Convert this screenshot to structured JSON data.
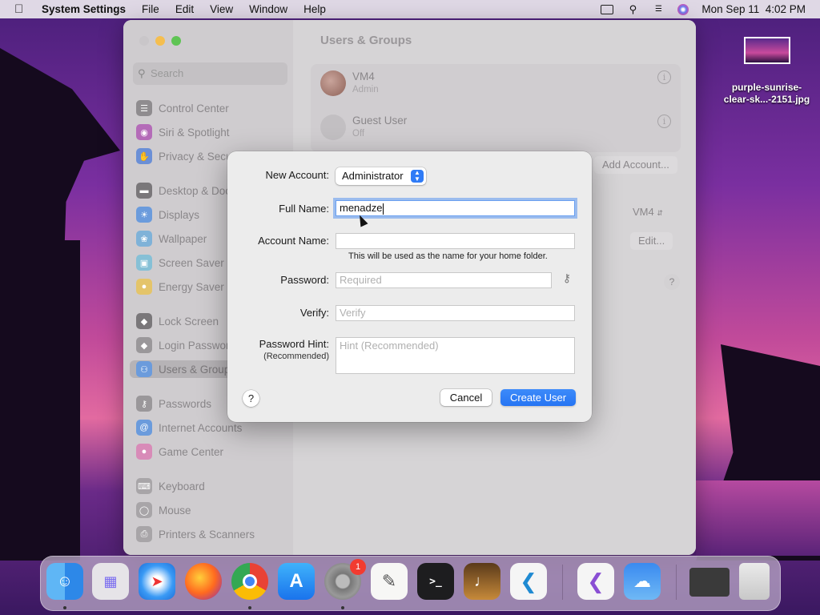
{
  "menubar": {
    "app_name": "System Settings",
    "menus": [
      "File",
      "Edit",
      "View",
      "Window",
      "Help"
    ],
    "clock": "Mon Sep 11  4:02 PM"
  },
  "desktop": {
    "file_name_line1": "purple-sunrise-",
    "file_name_line2": "clear-sk...-2151.jpg"
  },
  "window": {
    "title": "Users & Groups",
    "search_placeholder": "Search",
    "sidebar": [
      {
        "label": "Control Center",
        "icon": "control-center-icon",
        "color": "#8f8c8f"
      },
      {
        "label": "Siri & Spotlight",
        "icon": "siri-icon",
        "color": "#b46bb8"
      },
      {
        "label": "Privacy & Security",
        "icon": "hand-icon",
        "color": "#6b8fd6"
      },
      {
        "label": "Desktop & Dock",
        "icon": "dock-icon",
        "color": "#7a777a"
      },
      {
        "label": "Displays",
        "icon": "sun-icon",
        "color": "#6b9bdc"
      },
      {
        "label": "Wallpaper",
        "icon": "wallpaper-icon",
        "color": "#7fb2d8"
      },
      {
        "label": "Screen Saver",
        "icon": "screensaver-icon",
        "color": "#86c0d6"
      },
      {
        "label": "Energy Saver",
        "icon": "bulb-icon",
        "color": "#e4c46a"
      },
      {
        "label": "Lock Screen",
        "icon": "lock-icon",
        "color": "#7a777a"
      },
      {
        "label": "Login Password",
        "icon": "lock-icon",
        "color": "#9a979a"
      },
      {
        "label": "Users & Groups",
        "icon": "users-icon",
        "color": "#6b9bdc"
      },
      {
        "label": "Passwords",
        "icon": "key-icon",
        "color": "#9a979a"
      },
      {
        "label": "Internet Accounts",
        "icon": "at-icon",
        "color": "#6b9bdc"
      },
      {
        "label": "Game Center",
        "icon": "game-center-icon",
        "color": "#d88bb8"
      },
      {
        "label": "Keyboard",
        "icon": "keyboard-icon",
        "color": "#a8a5a8"
      },
      {
        "label": "Mouse",
        "icon": "mouse-icon",
        "color": "#a8a5a8"
      },
      {
        "label": "Printers & Scanners",
        "icon": "printer-icon",
        "color": "#a8a5a8"
      }
    ],
    "users": [
      {
        "name": "VM4",
        "role": "Admin"
      },
      {
        "name": "Guest User",
        "role": "Off"
      }
    ],
    "add_account_label": "Add Account...",
    "auto_login_value": "VM4",
    "edit_label": "Edit...",
    "help_label": "?"
  },
  "sheet": {
    "new_account_label": "New Account:",
    "new_account_value": "Administrator",
    "full_name_label": "Full Name:",
    "full_name_value": "menadze",
    "account_name_label": "Account Name:",
    "account_name_value": "",
    "account_name_help": "This will be used as the name for your home folder.",
    "password_label": "Password:",
    "password_placeholder": "Required",
    "verify_label": "Verify:",
    "verify_placeholder": "Verify",
    "hint_label": "Password Hint:",
    "hint_sublabel": "(Recommended)",
    "hint_placeholder": "Hint (Recommended)",
    "help_label": "?",
    "cancel_label": "Cancel",
    "create_label": "Create User"
  },
  "dock": {
    "apps": [
      "Finder",
      "Launchpad",
      "Safari",
      "Firefox",
      "Chrome",
      "App Store",
      "System Settings",
      "TextEdit",
      "Terminal",
      "Instruments",
      "VS Code",
      "Visual Studio",
      "Weather",
      "Screenshot",
      "Trash"
    ],
    "settings_badge": "1"
  }
}
